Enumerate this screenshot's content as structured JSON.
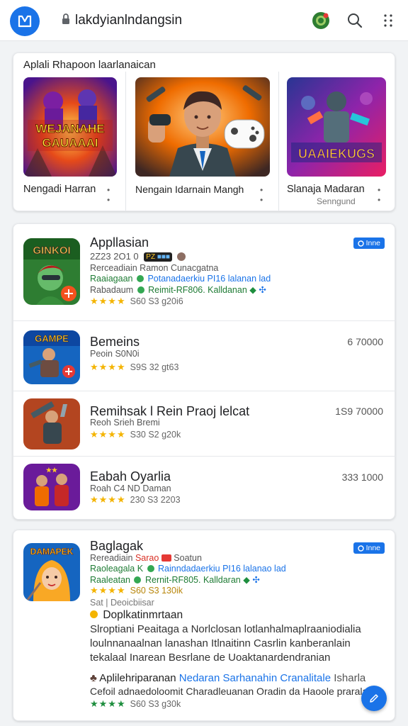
{
  "header": {
    "url": "lakdyianlndangsin"
  },
  "featured": {
    "title": "Aplali Rhapoon laarlanaican",
    "items": [
      {
        "name": "Nengadi Harran",
        "dots": "• •",
        "art_text": "WEJANAHE GAUAAAI"
      },
      {
        "name": "Nengain Idarnain Mangh",
        "dots": "• •"
      },
      {
        "name": "Slanaja Madaran",
        "dots": "• •",
        "sub": "Senngund",
        "art_text": "UAAIEKUGS"
      }
    ]
  },
  "list1": {
    "badge": "Inne",
    "apps": [
      {
        "name": "Appllasian",
        "icon_text": "GINKOI",
        "meta": "2Z23 2O1 0",
        "meta_tag": "PZ",
        "line1": "Rerceadiain Ramon Cunacgatna",
        "line2_a": "Raaiagaan",
        "line2_b": "Potanadaerkiu PI16 lalanan lad",
        "line3_a": "Rabadaum",
        "line3_b": "Reimit-RF806. Kalldanan",
        "rating": "S60 S3 g20i6"
      },
      {
        "name": "Bemeins",
        "icon_text": "GAMPE",
        "size": "6 70000",
        "line1": "Peoin S0N0i",
        "rating": "S9S 32 gt63"
      },
      {
        "name": "Remihsak l Rein Praoj lelcat",
        "size": "1S9 70000",
        "line1": "Reoh Srieh Bremi",
        "rating": "S30 S2 g20k"
      },
      {
        "name": "Eabah Oyarlia",
        "size": "333 1000",
        "line1": "Roah C4 ND Daman",
        "rating": "230 S3 2203"
      }
    ]
  },
  "detail": {
    "badge": "Inne",
    "name": "Baglagak",
    "icon_text": "DAMAPEK",
    "line1_a": "Rereadiain",
    "line1_tag": "Sarao",
    "line1_b": "Soatun",
    "line2_a": "Raoleagala K",
    "line2_b": "Rainndadaerkiu PI16 lalanao lad",
    "line3_a": "Raaleatan",
    "line3_b": "Rernit-RF805. Kalldaran",
    "rating": "S60 S3 130ik",
    "sub": "Sat | Deoicbiisar",
    "section_title": "Doplkatinmrtaan",
    "description": "Slroptiani Peaitaga a Norlclosan lotlanhalmaplraaniodialia loulnnanaalnan lanashan Itlnaitinn Casrlin kanberanlain tekalaal Inarean Besrlane de Uoaktanardendranian",
    "review_a": "Aplilehriparanan",
    "review_b": "Nedaran Sarhanahin Cranalitale",
    "review_c": "Isharla",
    "review_line": "Cefoil adnaedoloomit Charadleuanan Oradin da Haoole prarala",
    "review_rating": "S60 S3 g30k"
  },
  "colors": {
    "accent": "#1a73e8",
    "star": "#f4b400",
    "green": "#1e7b34"
  }
}
